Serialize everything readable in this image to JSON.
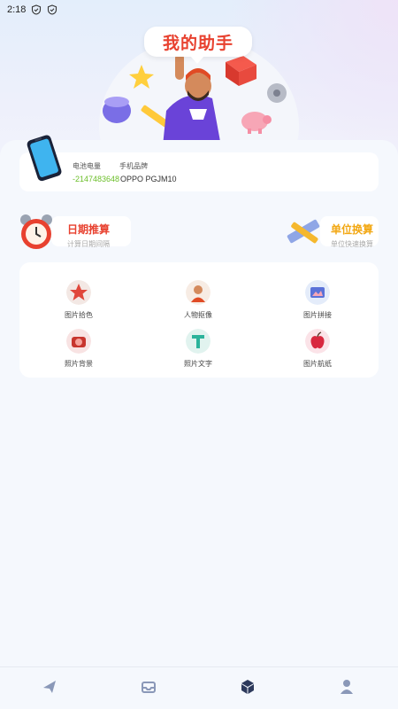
{
  "status_bar": {
    "time": "2:18"
  },
  "hero": {
    "title": "我的助手"
  },
  "phone_info": {
    "battery_label": "电池电量",
    "battery_value": "-2147483648",
    "brand_label": "手机品牌",
    "brand_value": "OPPO PGJM10"
  },
  "features": [
    {
      "title": "日期推算",
      "subtitle": "计算日期间隔"
    },
    {
      "title": "单位换算",
      "subtitle": "单位快速换算"
    }
  ],
  "tools": [
    {
      "label": "图片拾色"
    },
    {
      "label": "人物抠像"
    },
    {
      "label": "图片拼接"
    },
    {
      "label": "照片背景"
    },
    {
      "label": "照片文字"
    },
    {
      "label": "图片航纸"
    }
  ],
  "bottom_nav": [
    {
      "icon": "send-icon"
    },
    {
      "icon": "inbox-icon"
    },
    {
      "icon": "box-icon"
    },
    {
      "icon": "user-icon"
    }
  ],
  "colors": {
    "accent_red": "#e8412f",
    "accent_orange": "#f2a712",
    "battery_green": "#6cbf2a",
    "nav_active": "#2d3a5c",
    "nav_inactive": "#8a98b8"
  }
}
